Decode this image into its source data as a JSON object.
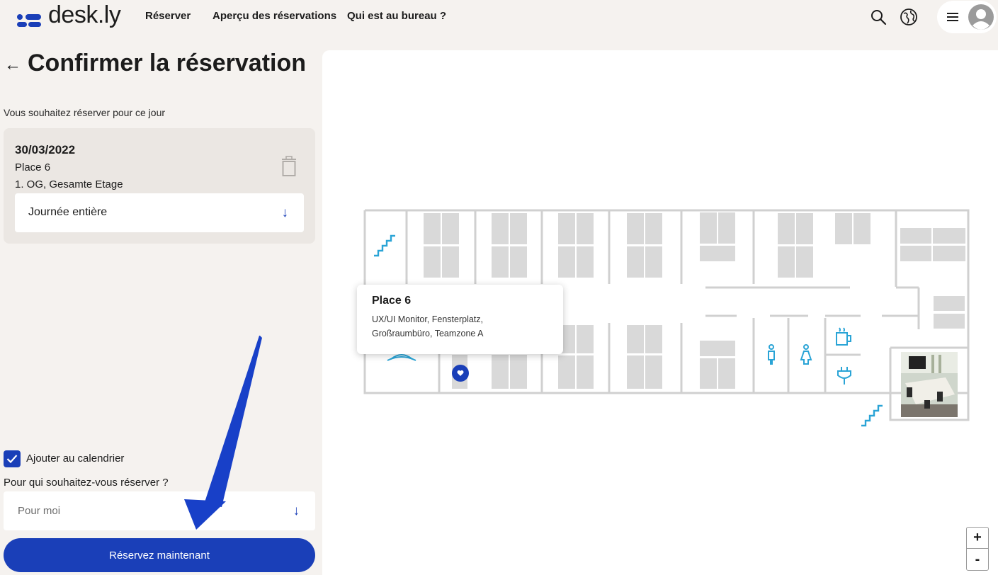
{
  "brand": {
    "name": "desk.ly",
    "accent": "#1a3fb8"
  },
  "nav": {
    "reserve": "Réserver",
    "overview": "Aperçu des réservations",
    "who": "Qui est au bureau ?"
  },
  "header_icons": [
    "search-icon",
    "globe-icon",
    "menu-icon",
    "avatar-icon"
  ],
  "page": {
    "title": "Confirmer la réservation",
    "day_label": "Vous souhaitez réserver pour ce jour"
  },
  "booking": {
    "date": "30/03/2022",
    "place": "Place 6",
    "floor": "1. OG, Gesamte Etage",
    "duration": "Journée entière"
  },
  "form": {
    "calendar_label": "Ajouter au calendrier",
    "calendar_checked": true,
    "for_who_label": "Pour qui souhaitez-vous réserver ?",
    "for_who_value": "Pour moi",
    "submit": "Réservez maintenant"
  },
  "map": {
    "tooltip_title": "Place 6",
    "tooltip_desc": "UX/UI Monitor, Fensterplatz, Großraumbüro, Teamzone A",
    "zoom_in": "+",
    "zoom_out": "-"
  }
}
